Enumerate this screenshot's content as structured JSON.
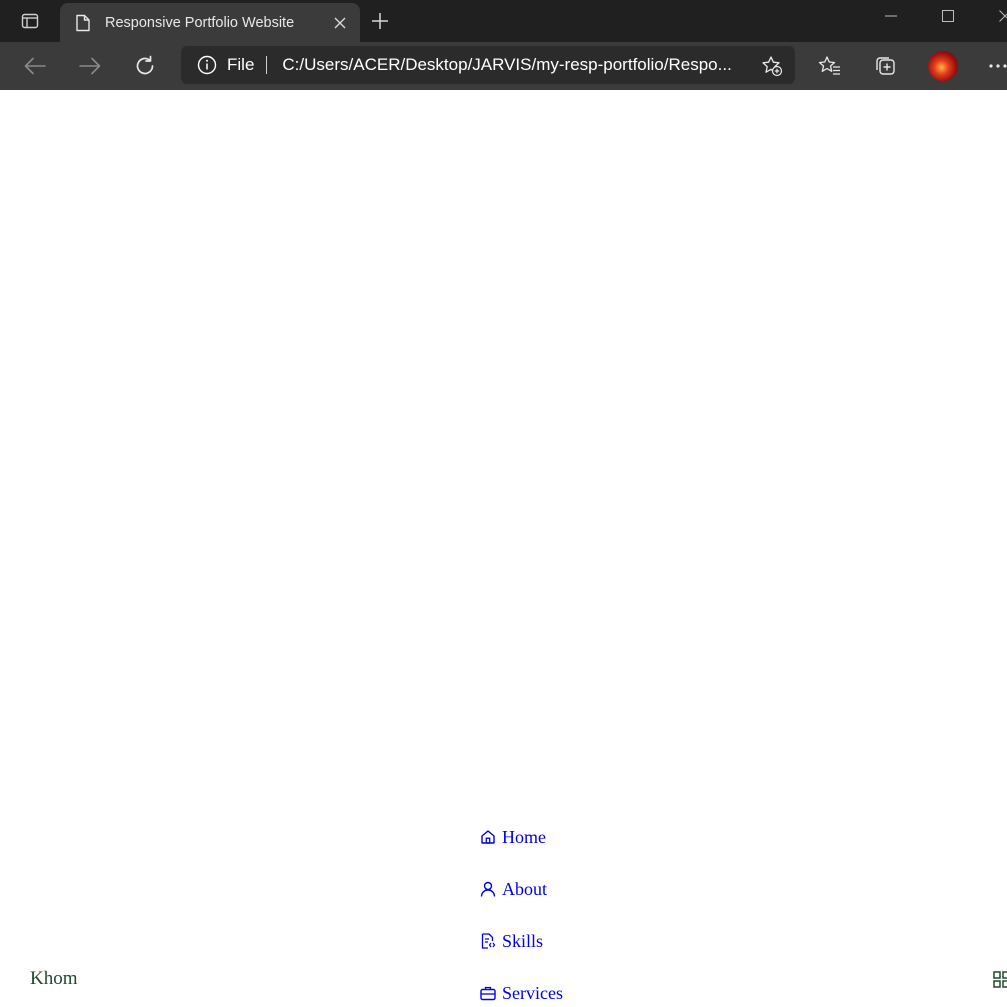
{
  "browser": {
    "tab": {
      "title": "Responsive Portfolio Website",
      "icon": "document-icon"
    },
    "address_bar": {
      "scheme": "File",
      "url": "C:/Users/ACER/Desktop/JARVIS/my-resp-portfolio/Respo..."
    }
  },
  "page": {
    "logo": "Khom",
    "nav": [
      {
        "label": "Home",
        "icon": "home-icon"
      },
      {
        "label": "About",
        "icon": "user-icon"
      },
      {
        "label": "Skills",
        "icon": "file-code-icon"
      },
      {
        "label": "Services",
        "icon": "briefcase-icon"
      }
    ],
    "nav_toggle_icon": "apps-grid-icon",
    "colors": {
      "link": "#0000ee",
      "logo": "#1e4a2c"
    }
  }
}
